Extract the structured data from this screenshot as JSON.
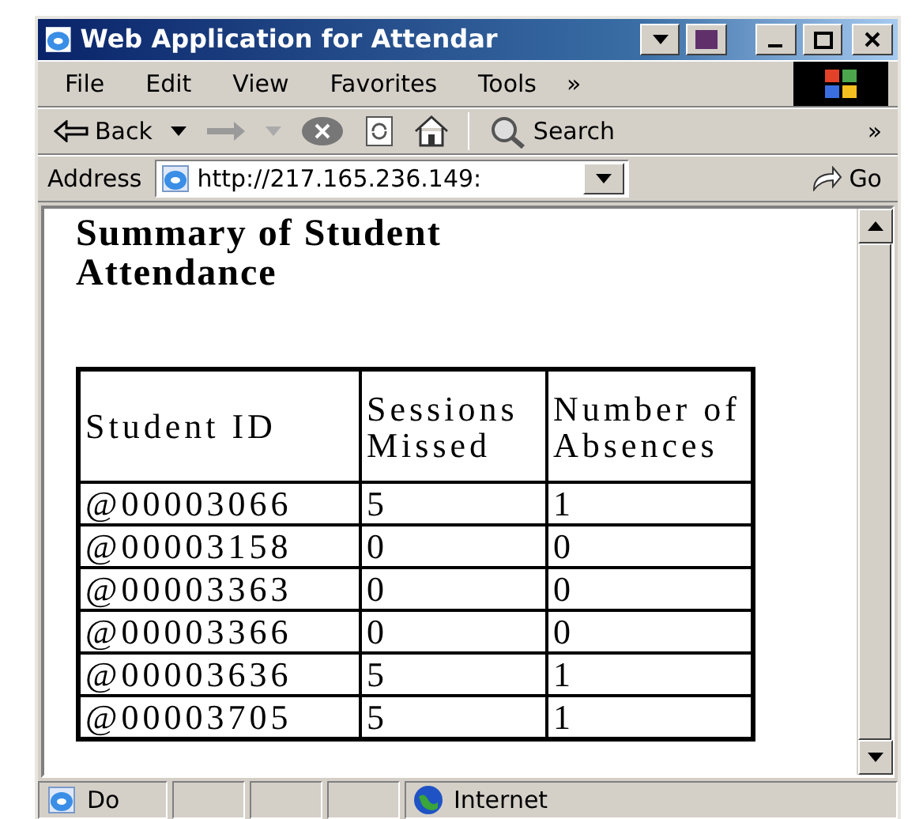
{
  "window": {
    "title": "Web Application for Attendar"
  },
  "menu": [
    {
      "label": "File"
    },
    {
      "label": "Edit"
    },
    {
      "label": "View"
    },
    {
      "label": "Favorites"
    },
    {
      "label": "Tools"
    }
  ],
  "menu_more": "»",
  "toolbar": {
    "back": "Back",
    "forward_disabled": true,
    "search": "Search",
    "more": "»"
  },
  "address": {
    "label": "Address",
    "url": "http://217.165.236.149:",
    "go": "Go"
  },
  "page": {
    "heading": "Summary of Student Attendance",
    "table": {
      "columns": [
        "Student ID",
        "Sessions Missed",
        "Number of Absences"
      ],
      "rows": [
        [
          "@00003066",
          "5",
          "1"
        ],
        [
          "@00003158",
          "0",
          "0"
        ],
        [
          "@00003363",
          "0",
          "0"
        ],
        [
          "@00003366",
          "0",
          "0"
        ],
        [
          "@00003636",
          "5",
          "1"
        ],
        [
          "@00003705",
          "5",
          "1"
        ]
      ]
    }
  },
  "status_bar": {
    "status": "Do",
    "zone": "Internet"
  }
}
